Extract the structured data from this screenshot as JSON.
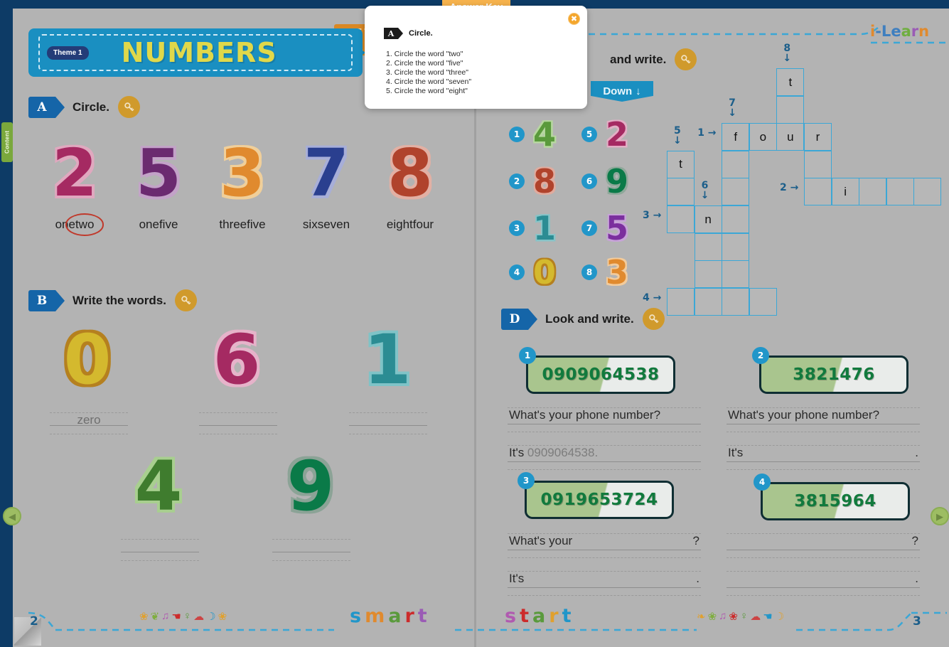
{
  "app": {
    "brand": "i-Learn",
    "brand_letters": [
      {
        "ch": "i",
        "color": "#e08a2e"
      },
      {
        "ch": "-",
        "color": "#3f7fbf"
      },
      {
        "ch": "L",
        "color": "#3f7fbf"
      },
      {
        "ch": "e",
        "color": "#3f7fbf"
      },
      {
        "ch": "a",
        "color": "#6fae3f"
      },
      {
        "ch": "r",
        "color": "#9a5bb5"
      },
      {
        "ch": "n",
        "color": "#e08a2e"
      }
    ],
    "content_tab_label": "Content",
    "nav_prev_icon": "chevron-left-icon",
    "nav_next_icon": "chevron-right-icon"
  },
  "banner": {
    "badge": "Theme 1",
    "title": "NUMBERS"
  },
  "answer_key": {
    "tab_label": "Answer Key",
    "close_icon": "close-icon",
    "section_letter": "A",
    "section_title": "Circle.",
    "items": [
      "1. Circle the word \"two\"",
      "2. Circle the word \"five\"",
      "3. Circle the word \"three\"",
      "4. Circle the word \"seven\"",
      "5. Circle the word \"eight\""
    ]
  },
  "exercise_a": {
    "letter": "A",
    "title": "Circle.",
    "key_icon": "key-icon",
    "items": [
      {
        "digit": "2",
        "color": "#a52a62",
        "shadow": "#e0a8bf",
        "options": [
          "one",
          "two"
        ],
        "circled": "two"
      },
      {
        "digit": "5",
        "color": "#6b2a70",
        "shadow": "#c3a2c8",
        "options": [
          "one",
          "five"
        ],
        "circled": ""
      },
      {
        "digit": "3",
        "color": "#e08a2e",
        "shadow": "#f0cf9a",
        "options": [
          "three",
          "five"
        ],
        "circled": ""
      },
      {
        "digit": "7",
        "color": "#2a3f8f",
        "shadow": "#a7aed8",
        "options": [
          "six",
          "seven"
        ],
        "circled": ""
      },
      {
        "digit": "8",
        "color": "#b0432c",
        "shadow": "#e2b0a4",
        "options": [
          "eight",
          "four"
        ],
        "circled": ""
      }
    ]
  },
  "exercise_b": {
    "letter": "B",
    "title": "Write the words.",
    "key_icon": "key-icon",
    "items": [
      {
        "digit": "0",
        "color": "#d4b92e",
        "shadow": "#b5801f",
        "answer": "zero"
      },
      {
        "digit": "6",
        "color": "#a52a62",
        "shadow": "#e6b3ca",
        "answer": ""
      },
      {
        "digit": "1",
        "color": "#2b8c93",
        "shadow": "#7fc3c7",
        "answer": ""
      },
      {
        "digit": "4",
        "color": "#3f7c2e",
        "shadow": "#a8cf8f",
        "answer": ""
      },
      {
        "digit": "9",
        "color": "#0a7a48",
        "shadow": "#8ba396",
        "answer": ""
      }
    ]
  },
  "exercise_c": {
    "letter": "C",
    "title": "and write.",
    "key_icon": "key-icon",
    "down_label": "Down",
    "down_icon": "arrow-down-icon",
    "items": [
      {
        "n": "1",
        "digit": "4",
        "color": "#5a9a3c",
        "shadow": "#b6d79f"
      },
      {
        "n": "2",
        "digit": "8",
        "color": "#b0432c",
        "shadow": "#e0ab9e"
      },
      {
        "n": "3",
        "digit": "1",
        "color": "#2b8c93",
        "shadow": "#86c4c8"
      },
      {
        "n": "4",
        "digit": "0",
        "color": "#d4b92e",
        "shadow": "#b5801f"
      },
      {
        "n": "5",
        "digit": "2",
        "color": "#a52a62",
        "shadow": "#e3aec5"
      },
      {
        "n": "6",
        "digit": "9",
        "color": "#0a7a48",
        "shadow": "#8fa89a"
      },
      {
        "n": "7",
        "digit": "5",
        "color": "#7b2f9e",
        "shadow": "#c7a3d8"
      },
      {
        "n": "8",
        "digit": "3",
        "color": "#e08a2e",
        "shadow": "#f2cb9c"
      }
    ],
    "crossword": {
      "cells": [
        {
          "c": 4,
          "r": 0,
          "letter": "t"
        },
        {
          "c": 4,
          "r": 1,
          "letter": ""
        },
        {
          "c": 2,
          "r": 2,
          "letter": "f"
        },
        {
          "c": 3,
          "r": 2,
          "letter": "o"
        },
        {
          "c": 4,
          "r": 2,
          "letter": "u"
        },
        {
          "c": 5,
          "r": 2,
          "letter": "r"
        },
        {
          "c": 0,
          "r": 3,
          "letter": "t"
        },
        {
          "c": 2,
          "r": 3,
          "letter": ""
        },
        {
          "c": 5,
          "r": 3,
          "letter": ""
        },
        {
          "c": 0,
          "r": 4,
          "letter": ""
        },
        {
          "c": 2,
          "r": 4,
          "letter": ""
        },
        {
          "c": 5,
          "r": 4,
          "letter": ""
        },
        {
          "c": 6,
          "r": 4,
          "letter": "i"
        },
        {
          "c": 7,
          "r": 4,
          "letter": ""
        },
        {
          "c": 8,
          "r": 4,
          "letter": ""
        },
        {
          "c": 9,
          "r": 4,
          "letter": ""
        },
        {
          "c": 0,
          "r": 5,
          "letter": ""
        },
        {
          "c": 1,
          "r": 5,
          "letter": "n"
        },
        {
          "c": 2,
          "r": 5,
          "letter": ""
        },
        {
          "c": 1,
          "r": 6,
          "letter": ""
        },
        {
          "c": 2,
          "r": 6,
          "letter": ""
        },
        {
          "c": 1,
          "r": 7,
          "letter": ""
        },
        {
          "c": 2,
          "r": 7,
          "letter": ""
        },
        {
          "c": 0,
          "r": 8,
          "letter": ""
        },
        {
          "c": 1,
          "r": 8,
          "letter": ""
        },
        {
          "c": 2,
          "r": 8,
          "letter": ""
        },
        {
          "c": 3,
          "r": 8,
          "letter": ""
        }
      ],
      "clues": [
        {
          "label": "5",
          "icon": "arrow-down-icon",
          "c": 0,
          "r": 3,
          "dir": "down"
        },
        {
          "label": "7",
          "icon": "arrow-down-icon",
          "c": 2,
          "r": 2,
          "dir": "down"
        },
        {
          "label": "8",
          "icon": "arrow-down-icon",
          "c": 4,
          "r": 0,
          "dir": "down"
        },
        {
          "label": "6",
          "icon": "arrow-down-icon",
          "c": 1,
          "r": 5,
          "dir": "down"
        },
        {
          "label": "1",
          "icon": "arrow-right-icon",
          "c": 2,
          "r": 2,
          "dir": "right"
        },
        {
          "label": "2",
          "icon": "arrow-right-icon",
          "c": 5,
          "r": 4,
          "dir": "right"
        },
        {
          "label": "3",
          "icon": "arrow-right-icon",
          "c": 0,
          "r": 5,
          "dir": "right"
        },
        {
          "label": "4",
          "icon": "arrow-right-icon",
          "c": 0,
          "r": 8,
          "dir": "right"
        }
      ]
    }
  },
  "exercise_d": {
    "letter": "D",
    "title": "Look and write.",
    "key_icon": "key-icon",
    "items": [
      {
        "n": "1",
        "phone": "0909064538",
        "q_prefix": "What's your phone number?",
        "q_suffix": "",
        "a_prefix": "It's",
        "a_value": "0909064538.",
        "end_mark": ""
      },
      {
        "n": "2",
        "phone": "3821476",
        "q_prefix": "What's your phone number?",
        "q_suffix": "",
        "a_prefix": "It's",
        "a_value": "",
        "end_mark": "."
      },
      {
        "n": "3",
        "phone": "0919653724",
        "q_prefix": "What's your",
        "q_suffix": "?",
        "a_prefix": "It's",
        "a_value": "",
        "end_mark": "."
      },
      {
        "n": "4",
        "phone": "3815964",
        "q_prefix": "",
        "q_suffix": "?",
        "a_prefix": "",
        "a_value": "",
        "end_mark": "."
      }
    ]
  },
  "footer": {
    "left_page": "2",
    "right_page": "3",
    "left_word": [
      {
        "ch": "s",
        "color": "#2196c9"
      },
      {
        "ch": "m",
        "color": "#e08a2e"
      },
      {
        "ch": "a",
        "color": "#5a9a3c"
      },
      {
        "ch": "r",
        "color": "#cc2b2b"
      },
      {
        "ch": "t",
        "color": "#9a5bb5"
      }
    ],
    "right_word": [
      {
        "ch": "s",
        "color": "#b05ab0"
      },
      {
        "ch": "t",
        "color": "#cc2b2b"
      },
      {
        "ch": "a",
        "color": "#5a9a3c"
      },
      {
        "ch": "r",
        "color": "#e0a02e"
      },
      {
        "ch": "t",
        "color": "#2196c9"
      }
    ],
    "left_icons": [
      "flower-icon",
      "leaf-icon",
      "music-note-icon",
      "hand-icon",
      "pin-icon",
      "cloud-icon",
      "moon-icon",
      "flower-icon"
    ],
    "right_icons": [
      "fish-icon",
      "flower-icon",
      "music-note-icon",
      "flower-icon",
      "pin-icon",
      "cloud-icon",
      "hand-icon",
      "moon-icon"
    ]
  }
}
